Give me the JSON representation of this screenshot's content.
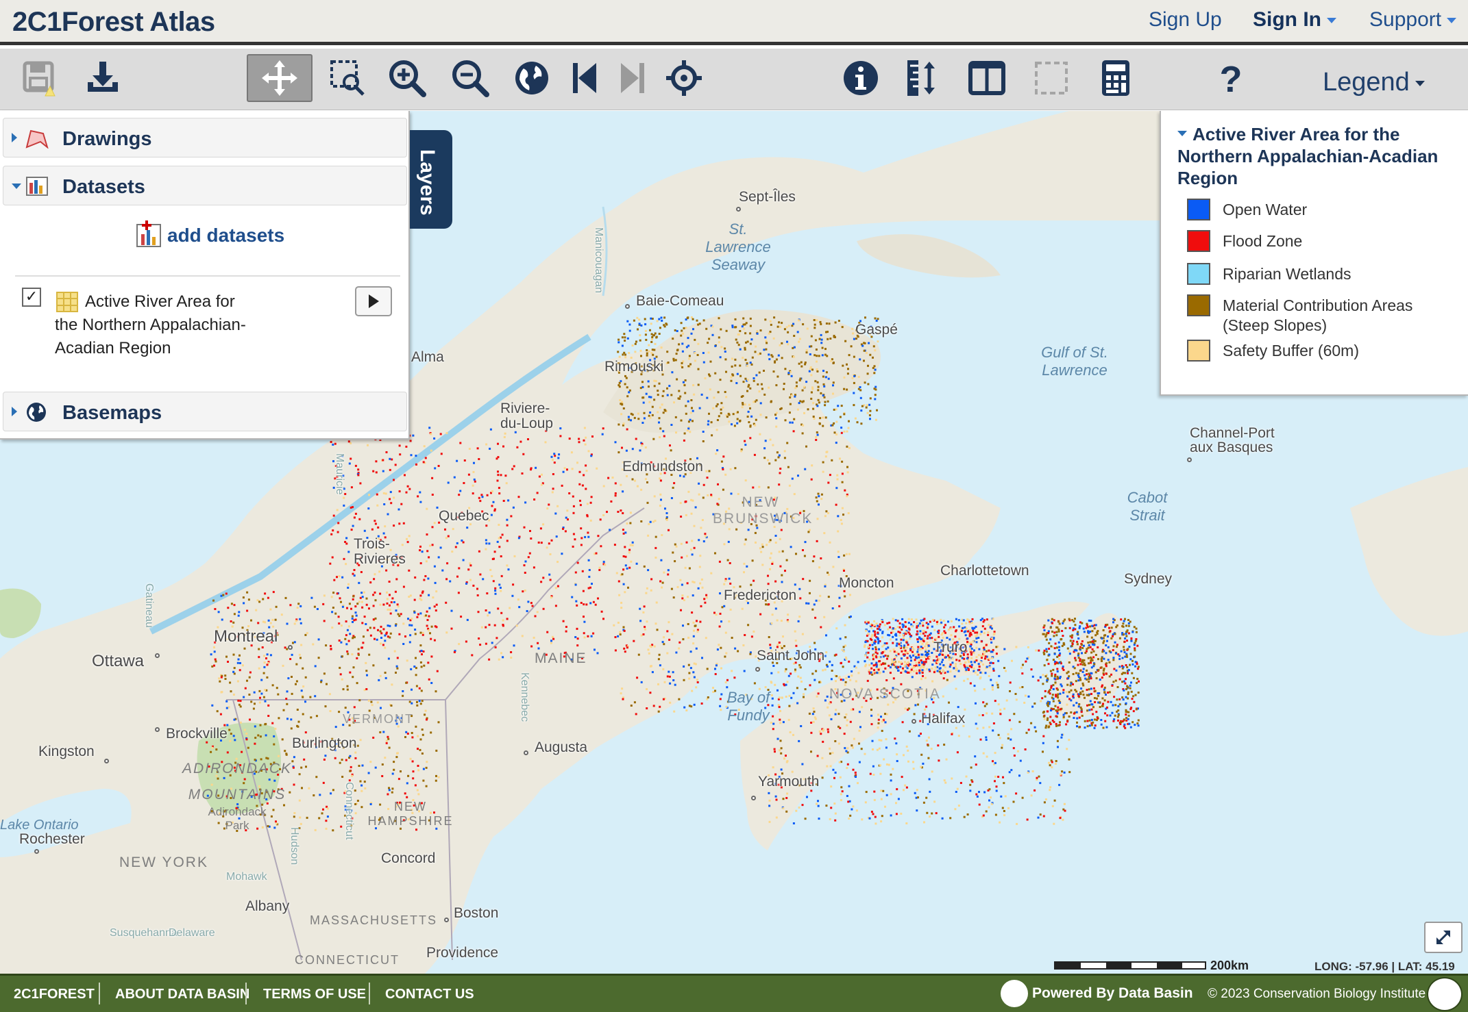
{
  "header": {
    "title": "2C1Forest Atlas",
    "sign_up": "Sign Up",
    "sign_in": "Sign In",
    "support": "Support"
  },
  "toolbar": {
    "legend_label": "Legend",
    "tools": [
      "save-icon",
      "download-icon",
      "pan-icon",
      "zoom-box-icon",
      "zoom-in-icon",
      "zoom-out-icon",
      "globe-icon",
      "previous-extent-icon",
      "next-extent-icon",
      "locate-icon",
      "info-icon",
      "measure-icon",
      "split-view-icon",
      "select-area-icon",
      "calculator-icon",
      "help-icon"
    ],
    "active_tool": "pan-icon"
  },
  "layers_panel": {
    "tab_label": "Layers",
    "sections": {
      "drawings": "Drawings",
      "datasets": "Datasets",
      "basemaps": "Basemaps"
    },
    "add_datasets": "add datasets",
    "dataset": {
      "checked": true,
      "name": "Active River Area for the Northern Appalachian-Acadian Region"
    }
  },
  "legend": {
    "title": "Active River Area for the Northern Appalachian-Acadian Region",
    "items": [
      {
        "label": "Open Water",
        "color": "#0a5bf5"
      },
      {
        "label": "Flood Zone",
        "color": "#f00d0d"
      },
      {
        "label": "Riparian Wetlands",
        "color": "#7fd8f7"
      },
      {
        "label": "Material Contribution Areas (Steep Slopes)",
        "color": "#9a6a00"
      },
      {
        "label": "Safety Buffer (60m)",
        "color": "#fbd78c"
      }
    ]
  },
  "map": {
    "places": [
      "Sept-Îles",
      "Baie-Comeau",
      "Gaspé",
      "Rimouski",
      "Alma",
      "Riviere-du-Loup",
      "Edmundston",
      "Quebec",
      "Trois-Rivieres",
      "Montreal",
      "Ottawa",
      "Brockville",
      "Kingston",
      "Burlington",
      "Fredericton",
      "Moncton",
      "Charlottetown",
      "Saint John",
      "Truro",
      "Halifax",
      "Yarmouth",
      "Sydney",
      "Channel-Port aux Basques",
      "Augusta",
      "Concord",
      "Albany",
      "Boston",
      "Providence",
      "Rochester"
    ],
    "water": [
      "St. Lawrence Seaway",
      "Gulf of St. Lawrence",
      "Cabot Strait",
      "Bay of Fundy",
      "Lake Ontario"
    ],
    "regions": [
      "MAINE",
      "NEW HAMPSHIRE",
      "NEW YORK",
      "MASSACHUSETTS",
      "CONNECTICUT",
      "ADIRONDACK MOUNTAINS",
      "Adirondack Park",
      "VERMONT",
      "NEW BRUNSWICK",
      "NOVA SCOTIA"
    ],
    "rivers": [
      "Manicouagan",
      "Mauricie",
      "Gatineau",
      "Kennebec",
      "Connecticut",
      "Hudson",
      "Mohawk",
      "Susquehanna",
      "Delaware"
    ],
    "scale_label": "200km",
    "coords": "LONG: -57.96 | LAT: 45.19"
  },
  "footer": {
    "links": [
      "2C1FOREST",
      "ABOUT DATA BASIN",
      "TERMS OF USE",
      "CONTACT US"
    ],
    "powered": "Powered By Data Basin",
    "copyright": "© 2023 Conservation Biology Institute"
  }
}
